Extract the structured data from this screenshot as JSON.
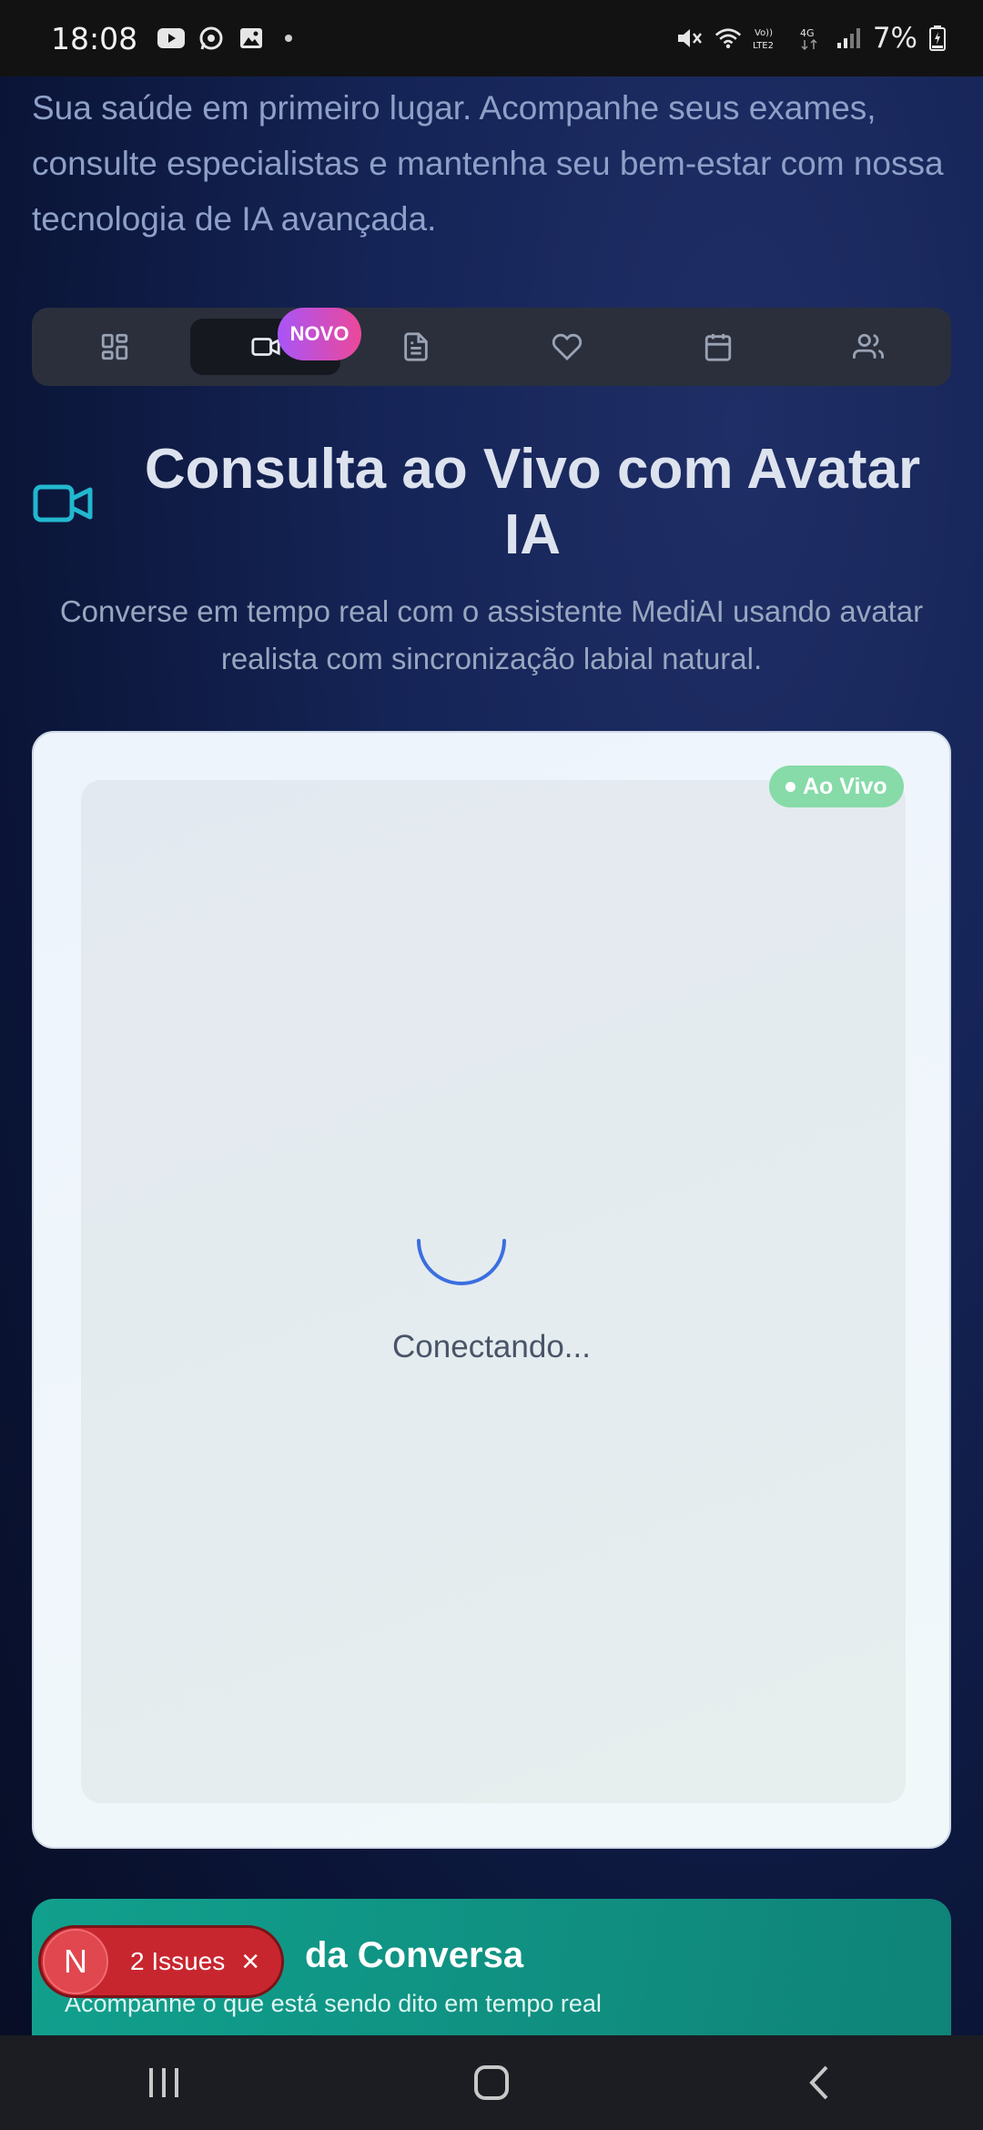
{
  "status_bar": {
    "time": "18:08",
    "left_icons": [
      "youtube-icon",
      "whatsapp-icon",
      "gallery-icon"
    ],
    "right_icons": [
      "mute-icon",
      "wifi-icon",
      "volte-icon",
      "signal-icon"
    ],
    "volte_label": "Vo)) LTE2",
    "network_label": "4G",
    "battery": "7%"
  },
  "intro": {
    "text": "Sua saúde em primeiro lugar. Acompanhe seus exames, consulte especialistas e mantenha seu bem-estar com nossa tecnologia de IA avançada."
  },
  "tabs": [
    {
      "icon": "dashboard-icon",
      "active": false
    },
    {
      "icon": "video-icon",
      "active": true,
      "badge": "NOVO"
    },
    {
      "icon": "document-icon",
      "active": false
    },
    {
      "icon": "heart-icon",
      "active": false
    },
    {
      "icon": "calendar-icon",
      "active": false
    },
    {
      "icon": "users-icon",
      "active": false
    }
  ],
  "section": {
    "title": "Consulta ao Vivo com Avatar IA",
    "subtitle": "Converse em tempo real com o assistente MediAI usando avatar realista com sincronização labial natural."
  },
  "video": {
    "live_badge": "Ao Vivo",
    "status": "Conectando..."
  },
  "transcript": {
    "title": "da Conversa",
    "subtitle": "Acompanhe o que está sendo dito em tempo real"
  },
  "issues": {
    "letter": "N",
    "label": "2 Issues",
    "close": "×"
  },
  "colors": {
    "accent_cyan": "#22b8cf",
    "live_green": "#86dba8",
    "badge_gradient_start": "#a855f7",
    "badge_gradient_end": "#ec4899",
    "issues_red": "#c8262f",
    "transcript_teal": "#11a08d"
  }
}
